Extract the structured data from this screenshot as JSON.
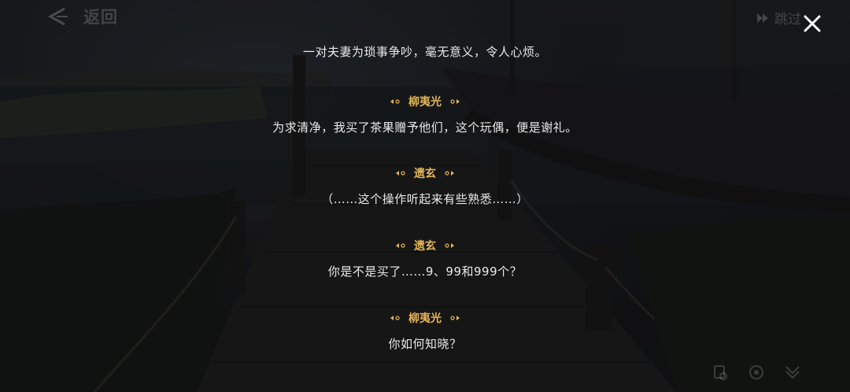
{
  "nav": {
    "back_label": "返回",
    "skip_label": "跳过"
  },
  "dialogue": [
    {
      "speaker": "",
      "text": "一对夫妻为琐事争吵，毫无意义，令人心烦。"
    },
    {
      "speaker": "柳夷光",
      "text": "为求清净，我买了茶果赠予他们，这个玩偶，便是谢礼。"
    },
    {
      "speaker": "遗玄",
      "text": "（……这个操作听起来有些熟悉……）"
    },
    {
      "speaker": "遗玄",
      "text": "你是不是买了……9、99和999个？"
    },
    {
      "speaker": "柳夷光",
      "text": "你如何知晓？"
    }
  ],
  "colors": {
    "speaker": "#e3b55a",
    "text": "#e9e9e9"
  },
  "icons": [
    "back-arrow-icon",
    "skip-icon",
    "close-icon",
    "history-icon",
    "auto-icon",
    "hide-icon"
  ]
}
